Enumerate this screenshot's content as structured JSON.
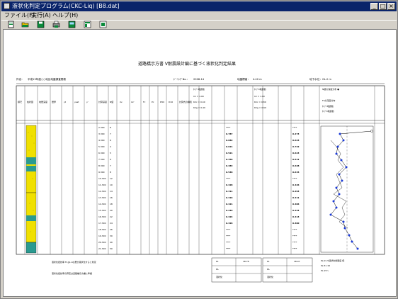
{
  "window": {
    "title": "液状化判定プログラム(CKC-Liq) [B8.dat]",
    "min_glyph": "_",
    "max_glyph": "□",
    "close_glyph": "×"
  },
  "menu": {
    "file": "ファイル(F)",
    "run": "実行(A)",
    "help": "ヘルプ(H)"
  },
  "toolbar": {
    "icons": [
      "new-icon",
      "open-icon",
      "save-icon",
      "print-icon",
      "input-icon",
      "calc-icon",
      "help-icon"
    ]
  },
  "report": {
    "title": "道路橋示方書 Ⅴ耐震設計編に基づく液状化判定結果",
    "project_label": "件名：",
    "project": "平成19年度○○地区地盤調査業務",
    "boring_label": "ﾎﾞｰﾘﾝｸﾞNo.：",
    "boring": "2008-14",
    "elevation_label": "地盤標高：",
    "elevation": "4.40 m",
    "gwl_label": "地下水位：GL-2 m",
    "col_headers": {
      "marker": "標尺",
      "column": "柱状図",
      "depth": "地層深度",
      "thick": "層厚",
      "g1": "γt",
      "g2": "γsat",
      "g3": "γ'",
      "calc_depth": "計算深度",
      "n": "N値",
      "sv": "σv",
      "sv2": "σv'",
      "fc": "Fc",
      "pc": "Pc",
      "d50": "D50",
      "d10": "D10",
      "judge": "計算式の種別"
    },
    "type1": {
      "label": "ﾀｲﾌﾟⅠ地震動",
      "cz": "Cz = 1.00",
      "khc": "Khc = 0.40",
      "khg": "Khg = 0.40",
      "cols": [
        "R",
        "L",
        "FL",
        "DE"
      ]
    },
    "type2": {
      "label": "ﾀｲﾌﾟⅡ地震動",
      "cz": "Cz = 1.00",
      "khc": "Khc = 0.80",
      "khg": "Khg = 0.60",
      "cols": [
        "R",
        "L",
        "FL",
        "DE"
      ]
    },
    "legend": {
      "title": "N値の深度分布 ●",
      "fl_title": "FLの深度分布",
      "type1": "ﾀｲﾌﾟⅠ地震動",
      "type2": "ﾀｲﾌﾟⅡ地震動"
    },
    "rows": [
      {
        "calc_depth": "2.300",
        "n": "8",
        "fl1": "****",
        "fl2": "****"
      },
      {
        "calc_depth": "3.300",
        "n": "7",
        "fl1": "0.787",
        "fl2": "0.273"
      },
      {
        "calc_depth": "4.300",
        "n": "6",
        "fl1": "0.682",
        "fl2": "0.623"
      },
      {
        "calc_depth": "5.300",
        "n": "4",
        "fl1": "0.621",
        "fl2": "0.742"
      },
      {
        "calc_depth": "6.300",
        "n": "5",
        "fl1": "0.521",
        "fl2": "0.623"
      },
      {
        "calc_depth": "7.300",
        "n": "9",
        "fl1": "0.356",
        "fl2": "0.611"
      },
      {
        "calc_depth": "8.300",
        "n": "7",
        "fl1": "0.483",
        "fl2": "0.628"
      },
      {
        "calc_depth": "9.300",
        "n": "8",
        "fl1": "0.548",
        "fl2": "0.615"
      },
      {
        "calc_depth": "10.300",
        "n": "12",
        "fl1": "****",
        "fl2": "****"
      },
      {
        "calc_depth": "11.300",
        "n": "10",
        "fl1": "0.428",
        "fl2": "0.426"
      },
      {
        "calc_depth": "12.300",
        "n": "14",
        "fl1": "0.311",
        "fl2": "0.293"
      },
      {
        "calc_depth": "13.300",
        "n": "16",
        "fl1": "0.416",
        "fl2": "0.411"
      },
      {
        "calc_depth": "14.300",
        "n": "18",
        "fl1": "0.421",
        "fl2": "0.406"
      },
      {
        "calc_depth": "15.300",
        "n": "20",
        "fl1": "0.249",
        "fl2": "0.224"
      },
      {
        "calc_depth": "16.300",
        "n": "22",
        "fl1": "0.424",
        "fl2": "0.413"
      },
      {
        "calc_depth": "17.300",
        "n": "24",
        "fl1": "0.326",
        "fl2": "0.300"
      },
      {
        "calc_depth": "18.300",
        "n": "26",
        "fl1": "****",
        "fl2": "****"
      },
      {
        "calc_depth": "19.300",
        "n": "30",
        "fl1": "****",
        "fl2": "****"
      },
      {
        "calc_depth": "20.300",
        "n": "40",
        "fl1": "****",
        "fl2": "****"
      },
      {
        "calc_depth": "21.300",
        "n": "50",
        "fl1": "****",
        "fl2": "****"
      }
    ],
    "footer": {
      "pl1_label": "PL",
      "pl1": "38.78",
      "pl2_label": "PL",
      "pl2": "38.97",
      "dl_label": "DL",
      "judge_label": "液状化",
      "note1": "PL:0～5液状化危険度 低",
      "note2": "PL:5～15",
      "note3": "PL:15～",
      "left_note1": "液状化抵抗率 FL≦1.0の層が液状化すると判定",
      "left_note2": "液状化抵抗率の算定は道路橋示方書に準拠"
    }
  }
}
